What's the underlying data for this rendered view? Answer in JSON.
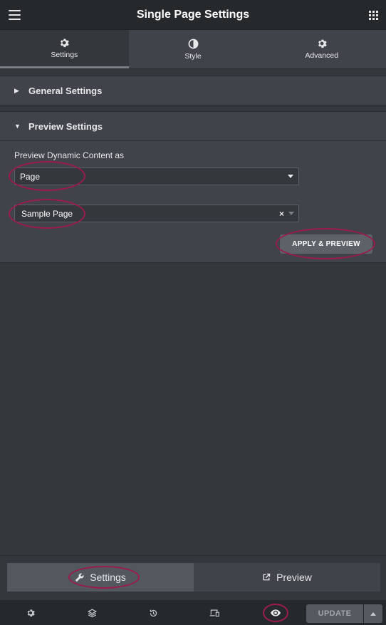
{
  "header": {
    "title": "Single Page Settings",
    "menu_icon": "hamburger-menu-icon",
    "apps_icon": "grid-apps-icon"
  },
  "tabs": [
    {
      "label": "Settings",
      "icon": "gear-icon",
      "active": true
    },
    {
      "label": "Style",
      "icon": "half-circle-icon",
      "active": false
    },
    {
      "label": "Advanced",
      "icon": "gear-icon",
      "active": false
    }
  ],
  "sections": {
    "general": {
      "label": "General Settings",
      "expanded": false
    },
    "preview": {
      "label": "Preview Settings",
      "expanded": true
    }
  },
  "preview": {
    "field_label": "Preview Dynamic Content as",
    "type_value": "Page",
    "item_value": "Sample Page",
    "clear_glyph": "×",
    "apply_label": "APPLY & PREVIEW"
  },
  "switcher": {
    "settings_label": "Settings",
    "preview_label": "Preview"
  },
  "footer": {
    "icons": [
      "gear-icon",
      "layers-icon",
      "history-icon",
      "responsive-icon",
      "eye-icon"
    ],
    "update_label": "UPDATE"
  },
  "colors": {
    "highlight": "#9a1b4d",
    "panel": "#404349",
    "background": "#34383c",
    "header": "#26292c"
  }
}
